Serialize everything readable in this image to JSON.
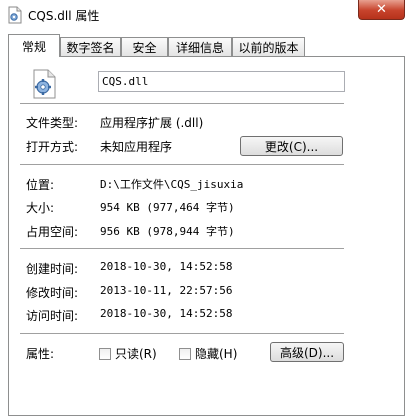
{
  "window": {
    "title": "CQS.dll 属性",
    "close_glyph": "✕"
  },
  "tabs": [
    {
      "label": "常规"
    },
    {
      "label": "数字签名"
    },
    {
      "label": "安全"
    },
    {
      "label": "详细信息"
    },
    {
      "label": "以前的版本"
    }
  ],
  "file": {
    "name": "CQS.dll"
  },
  "info": {
    "type_label": "文件类型:",
    "type_value": "应用程序扩展 (.dll)",
    "open_label": "打开方式:",
    "open_value": "未知应用程序",
    "change_button": "更改(C)...",
    "location_label": "位置:",
    "location_value": "D:\\工作文件\\CQS_jisuxia",
    "size_label": "大小:",
    "size_value": "954 KB (977,464 字节)",
    "disk_label": "占用空间:",
    "disk_value": "956 KB (978,944 字节)",
    "created_label": "创建时间:",
    "created_value": "2018-10-30, 14:52:58",
    "modified_label": "修改时间:",
    "modified_value": "2013-10-11, 22:57:56",
    "accessed_label": "访问时间:",
    "accessed_value": "2018-10-30, 14:52:58"
  },
  "attributes": {
    "label": "属性:",
    "readonly_label": "只读(R)",
    "hidden_label": "隐藏(H)",
    "advanced_button": "高级(D)..."
  }
}
